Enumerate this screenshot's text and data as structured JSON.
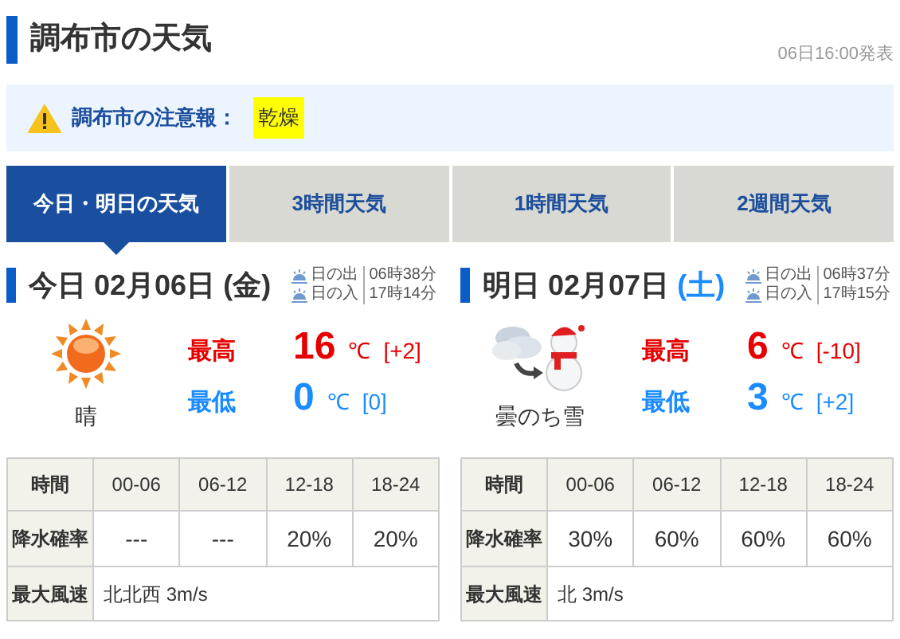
{
  "header": {
    "title": "調布市の天気",
    "issued": "06日16:00発表"
  },
  "alert": {
    "label": "調布市の注意報：",
    "items": [
      "乾燥"
    ]
  },
  "tabs": [
    {
      "label": "今日・明日の天気",
      "selected": true
    },
    {
      "label": "3時間天気",
      "selected": false
    },
    {
      "label": "1時間天気",
      "selected": false
    },
    {
      "label": "2週間天気",
      "selected": false
    }
  ],
  "days": [
    {
      "label": "今日",
      "date": "02月06日",
      "weekday": "(金)",
      "color": "#333333",
      "sunrise_label": "日の出",
      "sunrise": "06時38分",
      "sunset_label": "日の入",
      "sunset": "17時14分",
      "kind": "sunny",
      "weather": "晴",
      "high_label": "最高",
      "high": "16",
      "high_unit": "℃",
      "high_diff": "[+2]",
      "low_label": "最低",
      "low": "0",
      "low_unit": "℃",
      "low_diff": "[0]",
      "table": {
        "time_label": "時間",
        "periods": [
          "00-06",
          "06-12",
          "12-18",
          "18-24"
        ],
        "rain_label": "降水確率",
        "rain": [
          "---",
          "---",
          "20%",
          "20%"
        ],
        "wind_label": "最大風速",
        "wind": "北北西 3m/s"
      }
    },
    {
      "label": "明日",
      "date": "02月07日",
      "weekday": "(土)",
      "color": "#1a8cff",
      "sunrise_label": "日の出",
      "sunrise": "06時37分",
      "sunset_label": "日の入",
      "sunset": "17時15分",
      "kind": "cloudy_then_snow",
      "weather": "曇のち雪",
      "high_label": "最高",
      "high": "6",
      "high_unit": "℃",
      "high_diff": "[-10]",
      "low_label": "最低",
      "low": "3",
      "low_unit": "℃",
      "low_diff": "[+2]",
      "table": {
        "time_label": "時間",
        "periods": [
          "00-06",
          "06-12",
          "12-18",
          "18-24"
        ],
        "rain_label": "降水確率",
        "rain": [
          "30%",
          "60%",
          "60%",
          "60%"
        ],
        "wind_label": "最大風速",
        "wind": "北 3m/s"
      }
    }
  ]
}
